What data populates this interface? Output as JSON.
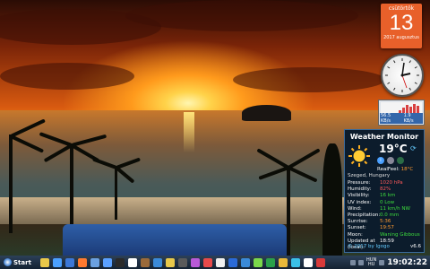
{
  "calendar": {
    "weekday": "csütörtök",
    "day": "13",
    "month_year": "2017 augusztus"
  },
  "network": {
    "down": "56.5 KB/s",
    "up": "1.9 KB/s"
  },
  "weather": {
    "title": "Weather Monitor",
    "temperature": "19°C",
    "realfeel_label": "RealFeel:",
    "realfeel_value": "18°C",
    "location": "Szeged, Hungary",
    "rows": [
      {
        "key": "Pressure:",
        "value": "1020 hPa",
        "color": "red"
      },
      {
        "key": "Humidity:",
        "value": "82%",
        "color": "red"
      },
      {
        "key": "Visibility:",
        "value": "16 km",
        "color": "green"
      },
      {
        "key": "UV index:",
        "value": "0 Low",
        "color": "green"
      },
      {
        "key": "Wind:",
        "value": "11 km/h NW",
        "color": "green"
      },
      {
        "key": "Precipitation:",
        "value": "0.0 mm",
        "color": "green"
      },
      {
        "key": "Sunrise:",
        "value": "5:36",
        "color": "orange"
      },
      {
        "key": "Sunset:",
        "value": "19:57",
        "color": "orange"
      },
      {
        "key": "Moon:",
        "value": "Waning Gibbous",
        "color": "green"
      },
      {
        "key": "Updated at (local):",
        "value": "18:59",
        "color": "white"
      }
    ],
    "copyright": "© 2017 by Igogo",
    "version": "v6.6"
  },
  "taskbar": {
    "start_label": "Start",
    "lang_top": "HUN",
    "lang_bottom": "HU",
    "time": "19:02:22",
    "icon_colors": [
      "#e8c84a",
      "#4aa0ff",
      "#3c78d8",
      "#ff7a30",
      "#6aa0e0",
      "#5aa0ff",
      "#2a2a2a",
      "#ffffff",
      "#9a6a3a",
      "#3a8ad8",
      "#e8c84a",
      "#5a5a5a",
      "#b85ad8",
      "#e84a4a",
      "#f0f0f0",
      "#2a6ad8",
      "#3a8ad8",
      "#7ad84a",
      "#2aa04a",
      "#e8b83a",
      "#3ac0e8",
      "#ffffff",
      "#d83a3a"
    ]
  }
}
